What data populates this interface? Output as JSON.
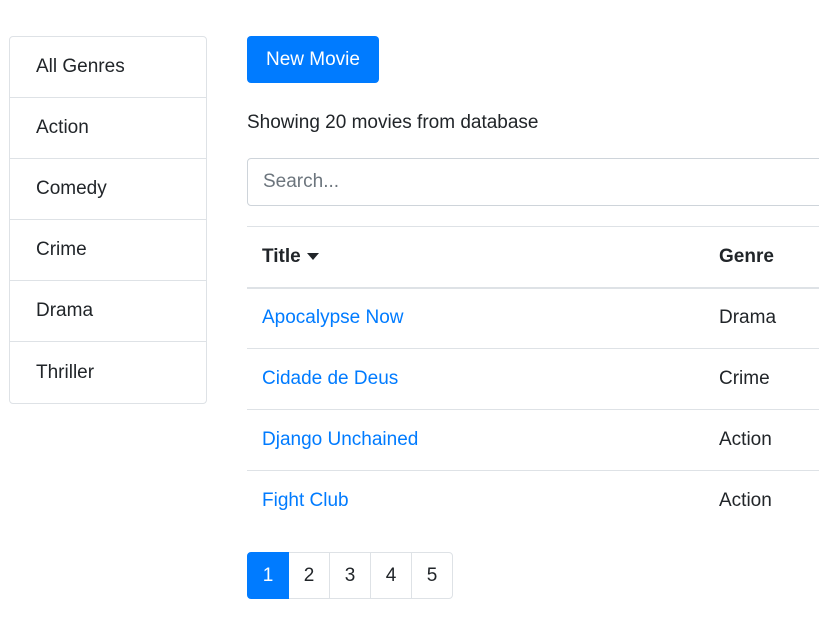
{
  "sidebar": {
    "genres": [
      "All Genres",
      "Action",
      "Comedy",
      "Crime",
      "Drama",
      "Thriller"
    ]
  },
  "toolbar": {
    "new_movie_label": "New Movie"
  },
  "summary": {
    "text": "Showing 20 movies from database"
  },
  "search": {
    "placeholder": "Search...",
    "value": ""
  },
  "table": {
    "columns": [
      "Title",
      "Genre"
    ],
    "sort": {
      "column": "Title",
      "direction": "descending-caret"
    },
    "rows": [
      {
        "title": "Apocalypse Now",
        "genre": "Drama"
      },
      {
        "title": "Cidade de Deus",
        "genre": "Crime"
      },
      {
        "title": "Django Unchained",
        "genre": "Action"
      },
      {
        "title": "Fight Club",
        "genre": "Action"
      }
    ]
  },
  "pagination": {
    "pages": [
      "1",
      "2",
      "3",
      "4",
      "5"
    ],
    "current": "1"
  },
  "colors": {
    "primary": "#007bff",
    "text": "#212529",
    "border": "#dee2e6"
  }
}
